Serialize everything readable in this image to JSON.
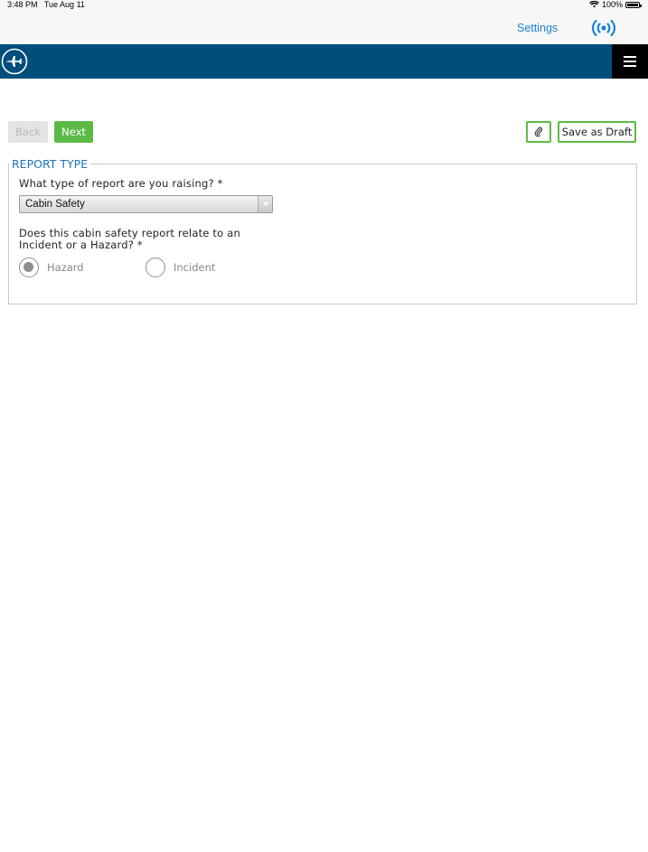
{
  "status_bar": {
    "time": "3:48 PM",
    "date": "Tue Aug 11",
    "battery": "100%"
  },
  "top_nav": {
    "settings_label": "Settings"
  },
  "toolbar": {
    "back_label": "Back",
    "next_label": "Next",
    "save_draft_label": "Save as Draft"
  },
  "form": {
    "section_title": "REPORT TYPE",
    "question_report_type": "What type of report are you raising? *",
    "report_type_selected": "Cabin Safety",
    "question_incident_hazard": "Does this cabin safety report relate to an Incident or a Hazard? *",
    "options": [
      {
        "label": "Hazard",
        "checked": true
      },
      {
        "label": "Incident",
        "checked": false
      }
    ]
  },
  "colors": {
    "header_blue": "#004e7c",
    "accent_green": "#5dba47",
    "link_blue": "#1b83d3",
    "legend_blue": "#1e74b8"
  }
}
